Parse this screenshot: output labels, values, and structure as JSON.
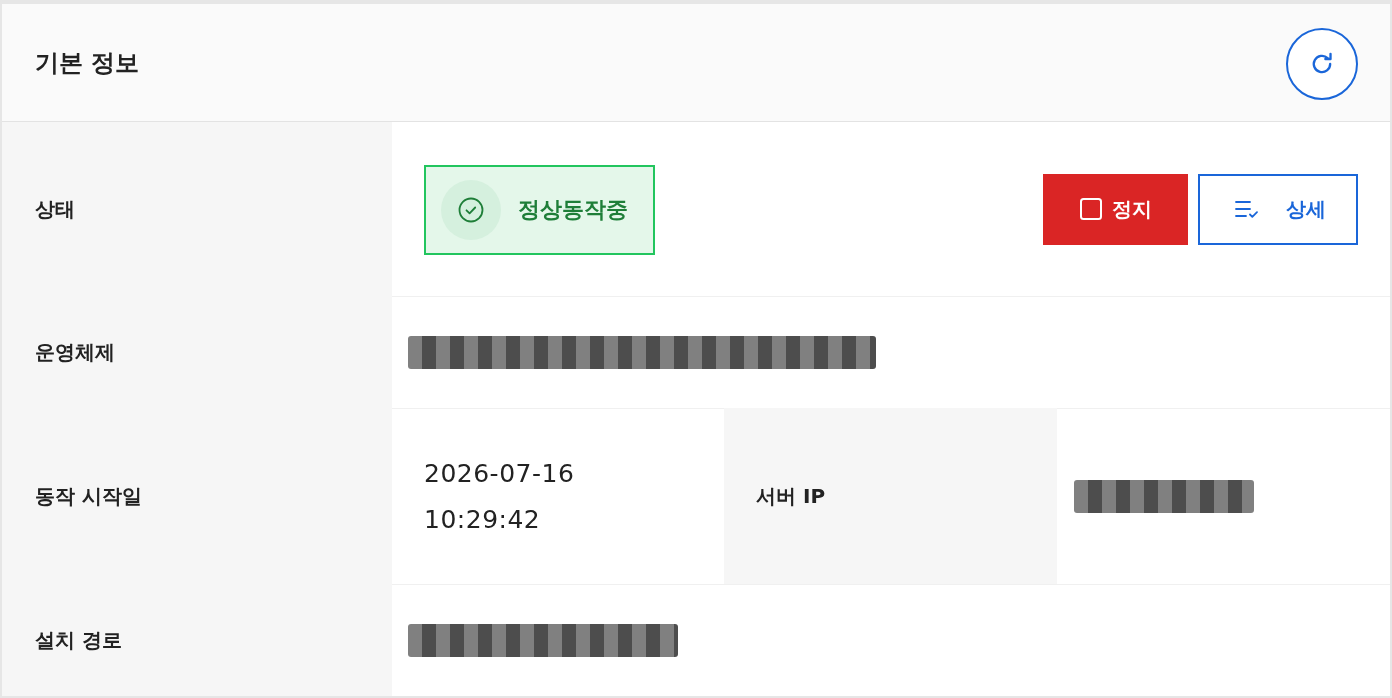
{
  "panel": {
    "title": "기본 정보"
  },
  "rows": [
    {
      "kind": "status",
      "label": "상태",
      "status": {
        "text": "정상동작중",
        "ok": true
      },
      "actions": [
        {
          "kind": "stop",
          "label": "정지"
        },
        {
          "kind": "detail",
          "label": "상세"
        }
      ]
    },
    {
      "kind": "field",
      "label": "운영체제",
      "value": {
        "redacted": true
      }
    },
    {
      "kind": "split",
      "label": "동작 시작일",
      "value": {
        "redacted": false,
        "text": "2026-07-16 10:29:42"
      },
      "second_label": "서버 IP",
      "second_value": {
        "redacted": true
      }
    },
    {
      "kind": "field",
      "label": "설치 경로",
      "value": {
        "redacted": true
      }
    }
  ]
}
